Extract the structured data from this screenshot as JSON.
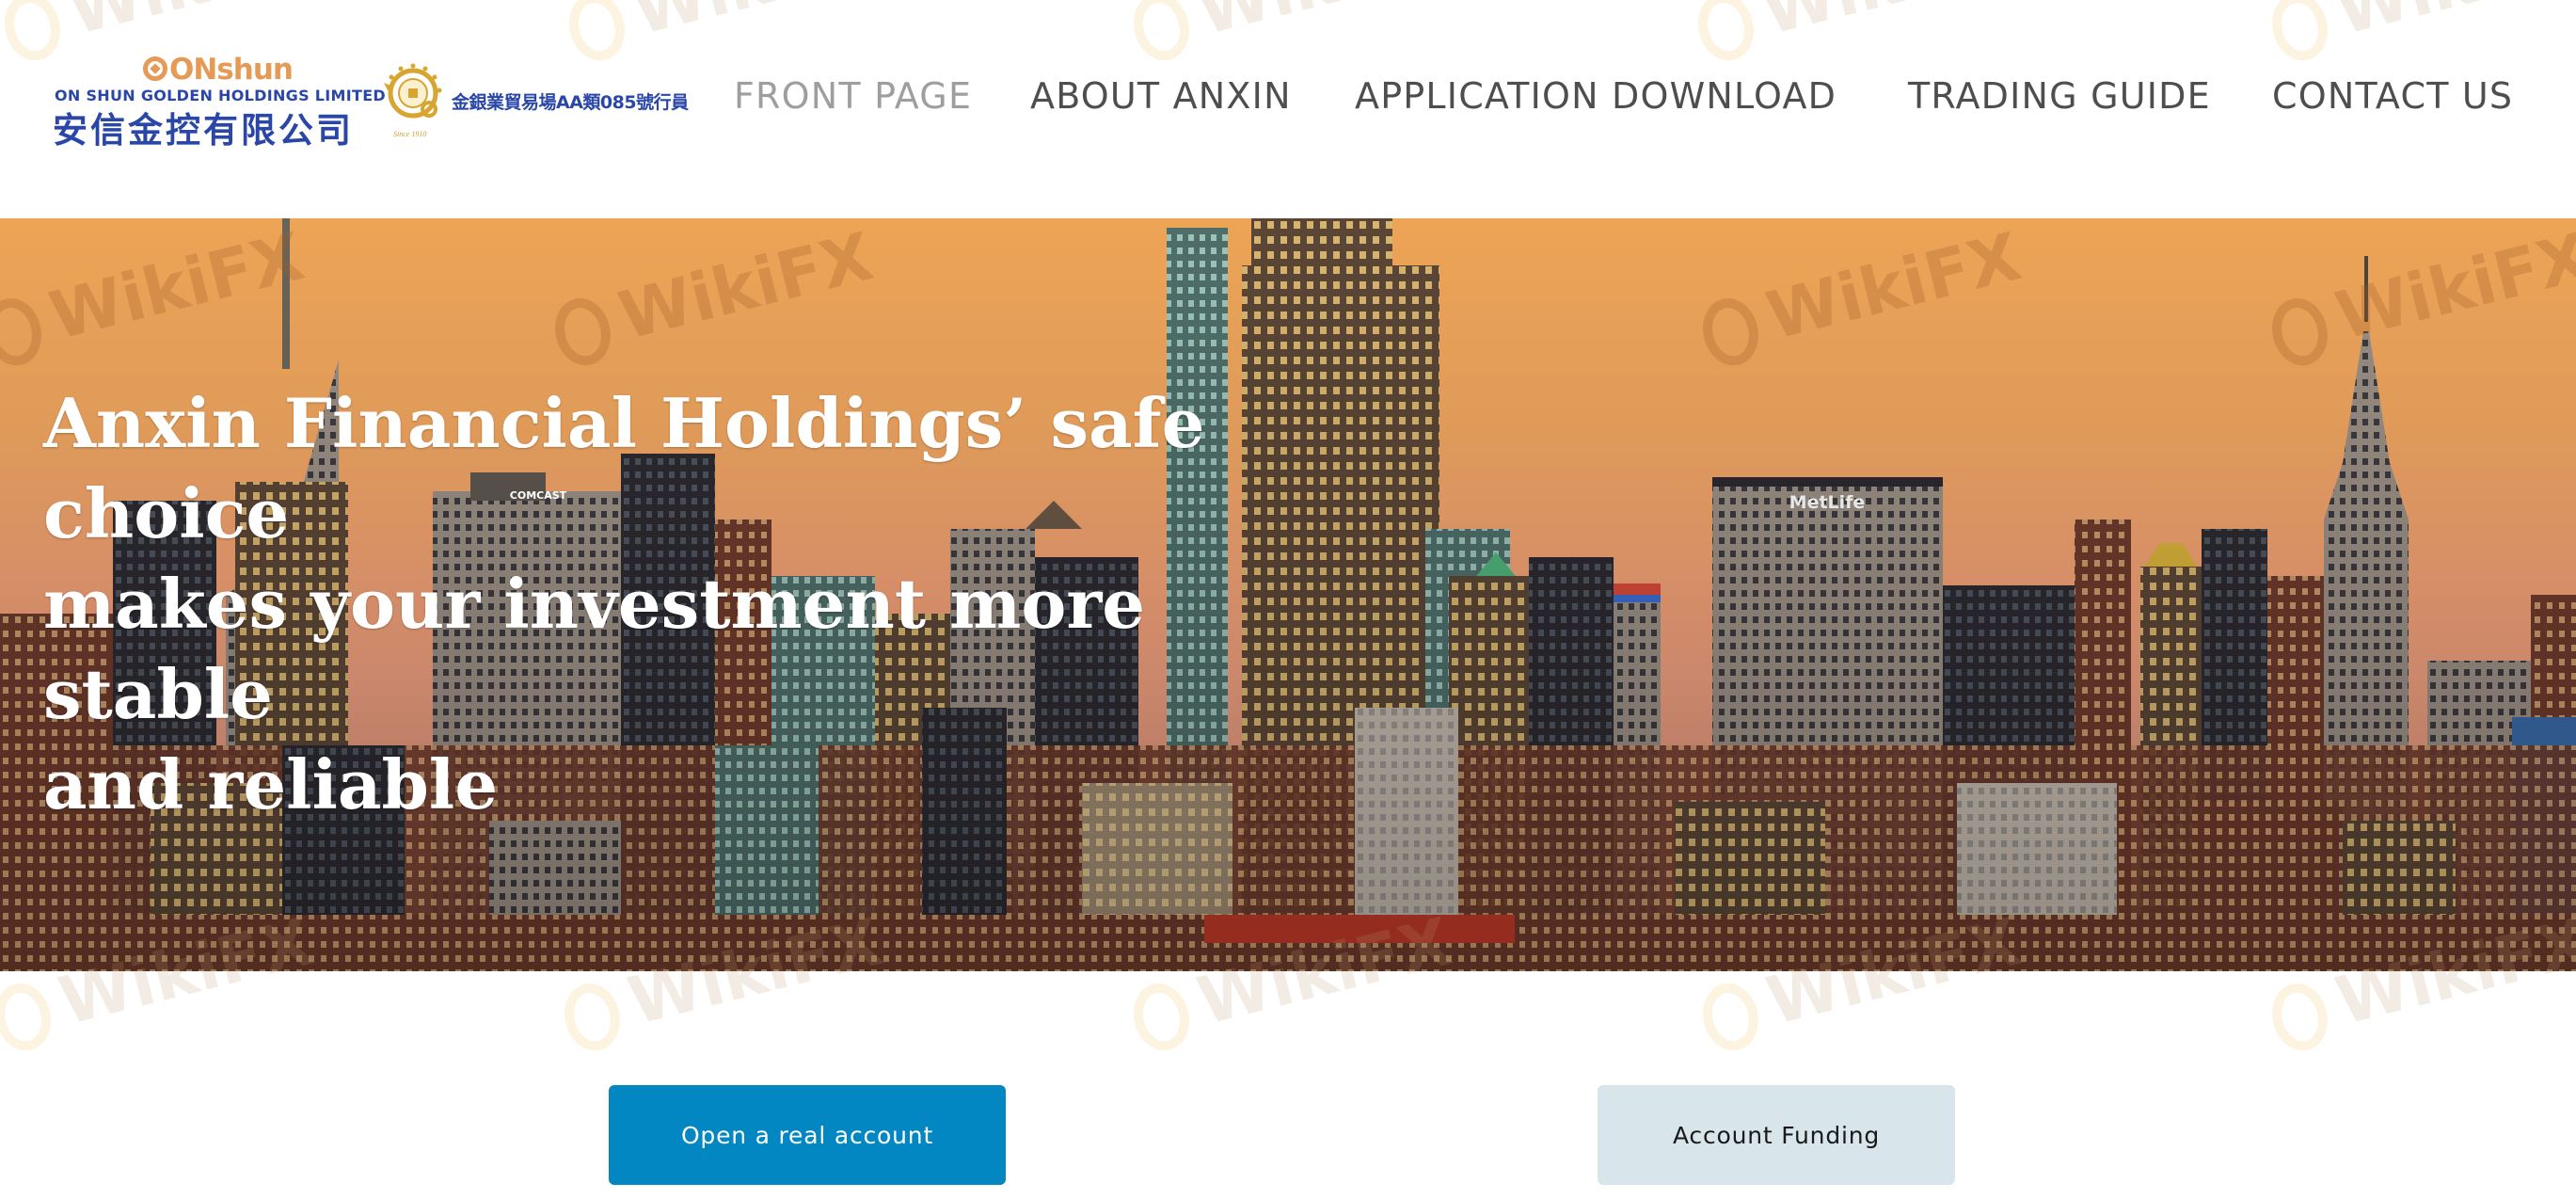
{
  "header": {
    "logo": {
      "brand_mark": "ONshun",
      "english_name": "ON SHUN GOLDEN HOLDINGS LIMITED",
      "chinese_name": "安信金控有限公司",
      "emblem_icon": "gold-silver-exchange-emblem",
      "emblem_caption": "Since 1910",
      "membership_text": "金銀業貿易場AA類085號行員"
    },
    "nav": {
      "items": [
        {
          "label": "FRONT PAGE",
          "active": true
        },
        {
          "label": "ABOUT ANXIN",
          "active": false
        },
        {
          "label": "APPLICATION DOWNLOAD",
          "active": false
        },
        {
          "label": "TRADING GUIDE",
          "active": false
        },
        {
          "label": "CONTACT US",
          "active": false
        }
      ]
    }
  },
  "hero": {
    "headline_lines": [
      "Anxin Financial Holdings’ safe",
      "choice",
      "makes your investment more stable",
      "and reliable"
    ],
    "image": "new-york-skyline-at-sunset",
    "building_signs": [
      "COMCAST",
      "MetLife"
    ]
  },
  "watermark": {
    "text": "WikiFX"
  },
  "actions": {
    "open_account_label": "Open a real account",
    "account_funding_label": "Account Funding"
  },
  "colors": {
    "primary_button": "#0387c3",
    "secondary_button": "#d8e5ea",
    "nav_text": "#4e4e4e",
    "nav_active": "#9e9e9e",
    "brand_blue": "#2a47a8",
    "brand_gold": "#e59a55"
  }
}
